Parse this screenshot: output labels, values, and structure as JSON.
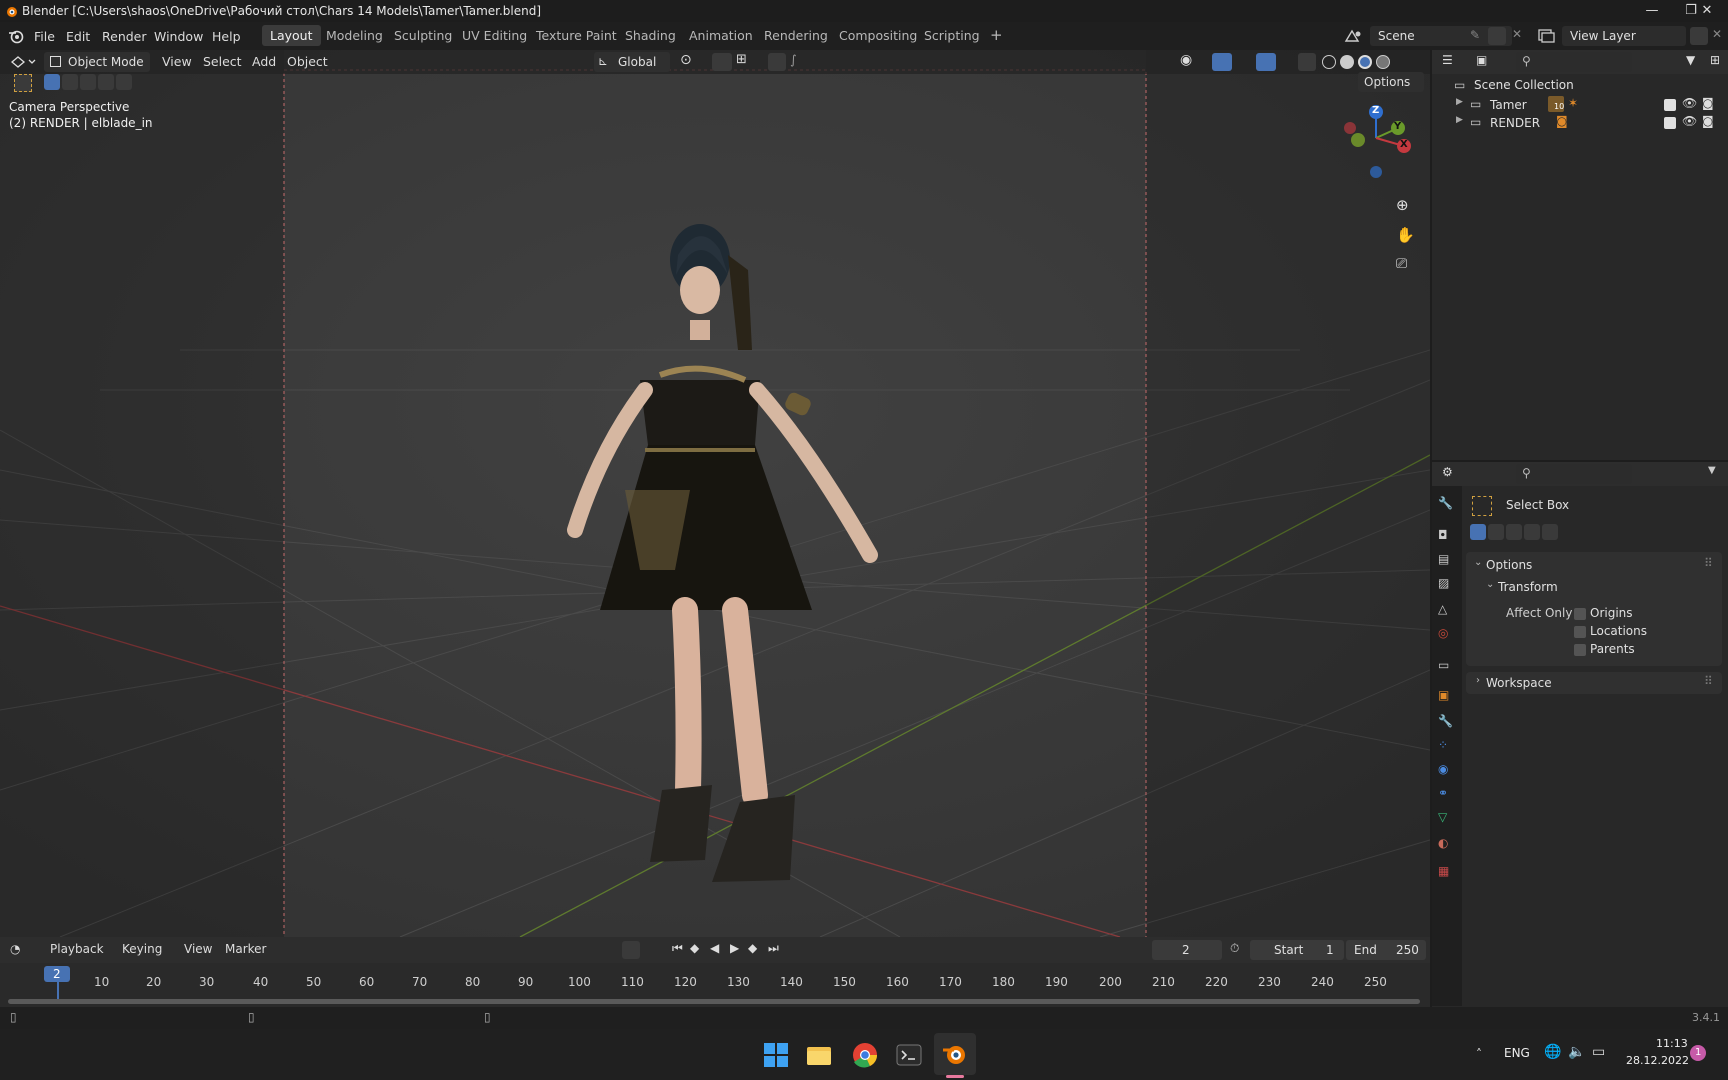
{
  "window": {
    "title": "Blender [C:\\Users\\shaos\\OneDrive\\Рабочий стол\\Chars 14 Models\\Tamer\\Tamer.blend]",
    "minimize": "—",
    "maximize": "❐",
    "close": "✕"
  },
  "menubar": {
    "items": [
      "File",
      "Edit",
      "Render",
      "Window",
      "Help"
    ],
    "workspaces": [
      "Layout",
      "Modeling",
      "Sculpting",
      "UV Editing",
      "Texture Paint",
      "Shading",
      "Animation",
      "Rendering",
      "Compositing",
      "Scripting"
    ],
    "active_workspace": "Layout",
    "add_workspace": "+",
    "scene": "Scene",
    "view_layer": "View Layer"
  },
  "viewport": {
    "mode": "Object Mode",
    "menus": [
      "View",
      "Select",
      "Add",
      "Object"
    ],
    "transform_orientation": "Global",
    "options_label": "Options",
    "camera_label": "Camera Perspective",
    "object_label": "(2) RENDER | elblade_in",
    "gizmo_z": "Z",
    "gizmo_y": "Y",
    "gizmo_x": "X"
  },
  "outliner": {
    "root": "Scene Collection",
    "collections": [
      {
        "name": "Tamer",
        "badge": "10"
      },
      {
        "name": "RENDER",
        "badge": ""
      }
    ]
  },
  "properties": {
    "tool_name": "Select Box",
    "options_panel": "Options",
    "transform_panel": "Transform",
    "affect_only_label": "Affect Only",
    "affect_only": [
      "Origins",
      "Locations",
      "Parents"
    ],
    "workspace_panel": "Workspace"
  },
  "timeline": {
    "menus": [
      "Playback",
      "Keying",
      "View",
      "Marker"
    ],
    "current_frame": "2",
    "start_label": "Start",
    "start": "1",
    "end_label": "End",
    "end": "250",
    "ticks": [
      "10",
      "20",
      "30",
      "40",
      "50",
      "60",
      "70",
      "80",
      "90",
      "100",
      "110",
      "120",
      "130",
      "140",
      "150",
      "160",
      "170",
      "180",
      "190",
      "200",
      "210",
      "220",
      "230",
      "240",
      "250"
    ]
  },
  "statusbar": {
    "version": "3.4.1"
  },
  "taskbar": {
    "language": "ENG",
    "time": "11:13",
    "date": "28.12.2022",
    "notifications": "1"
  },
  "colors": {
    "accent": "#4772b3",
    "axis_x": "#c5393f",
    "axis_y": "#6a9a2a",
    "axis_z": "#2f6fd0"
  }
}
